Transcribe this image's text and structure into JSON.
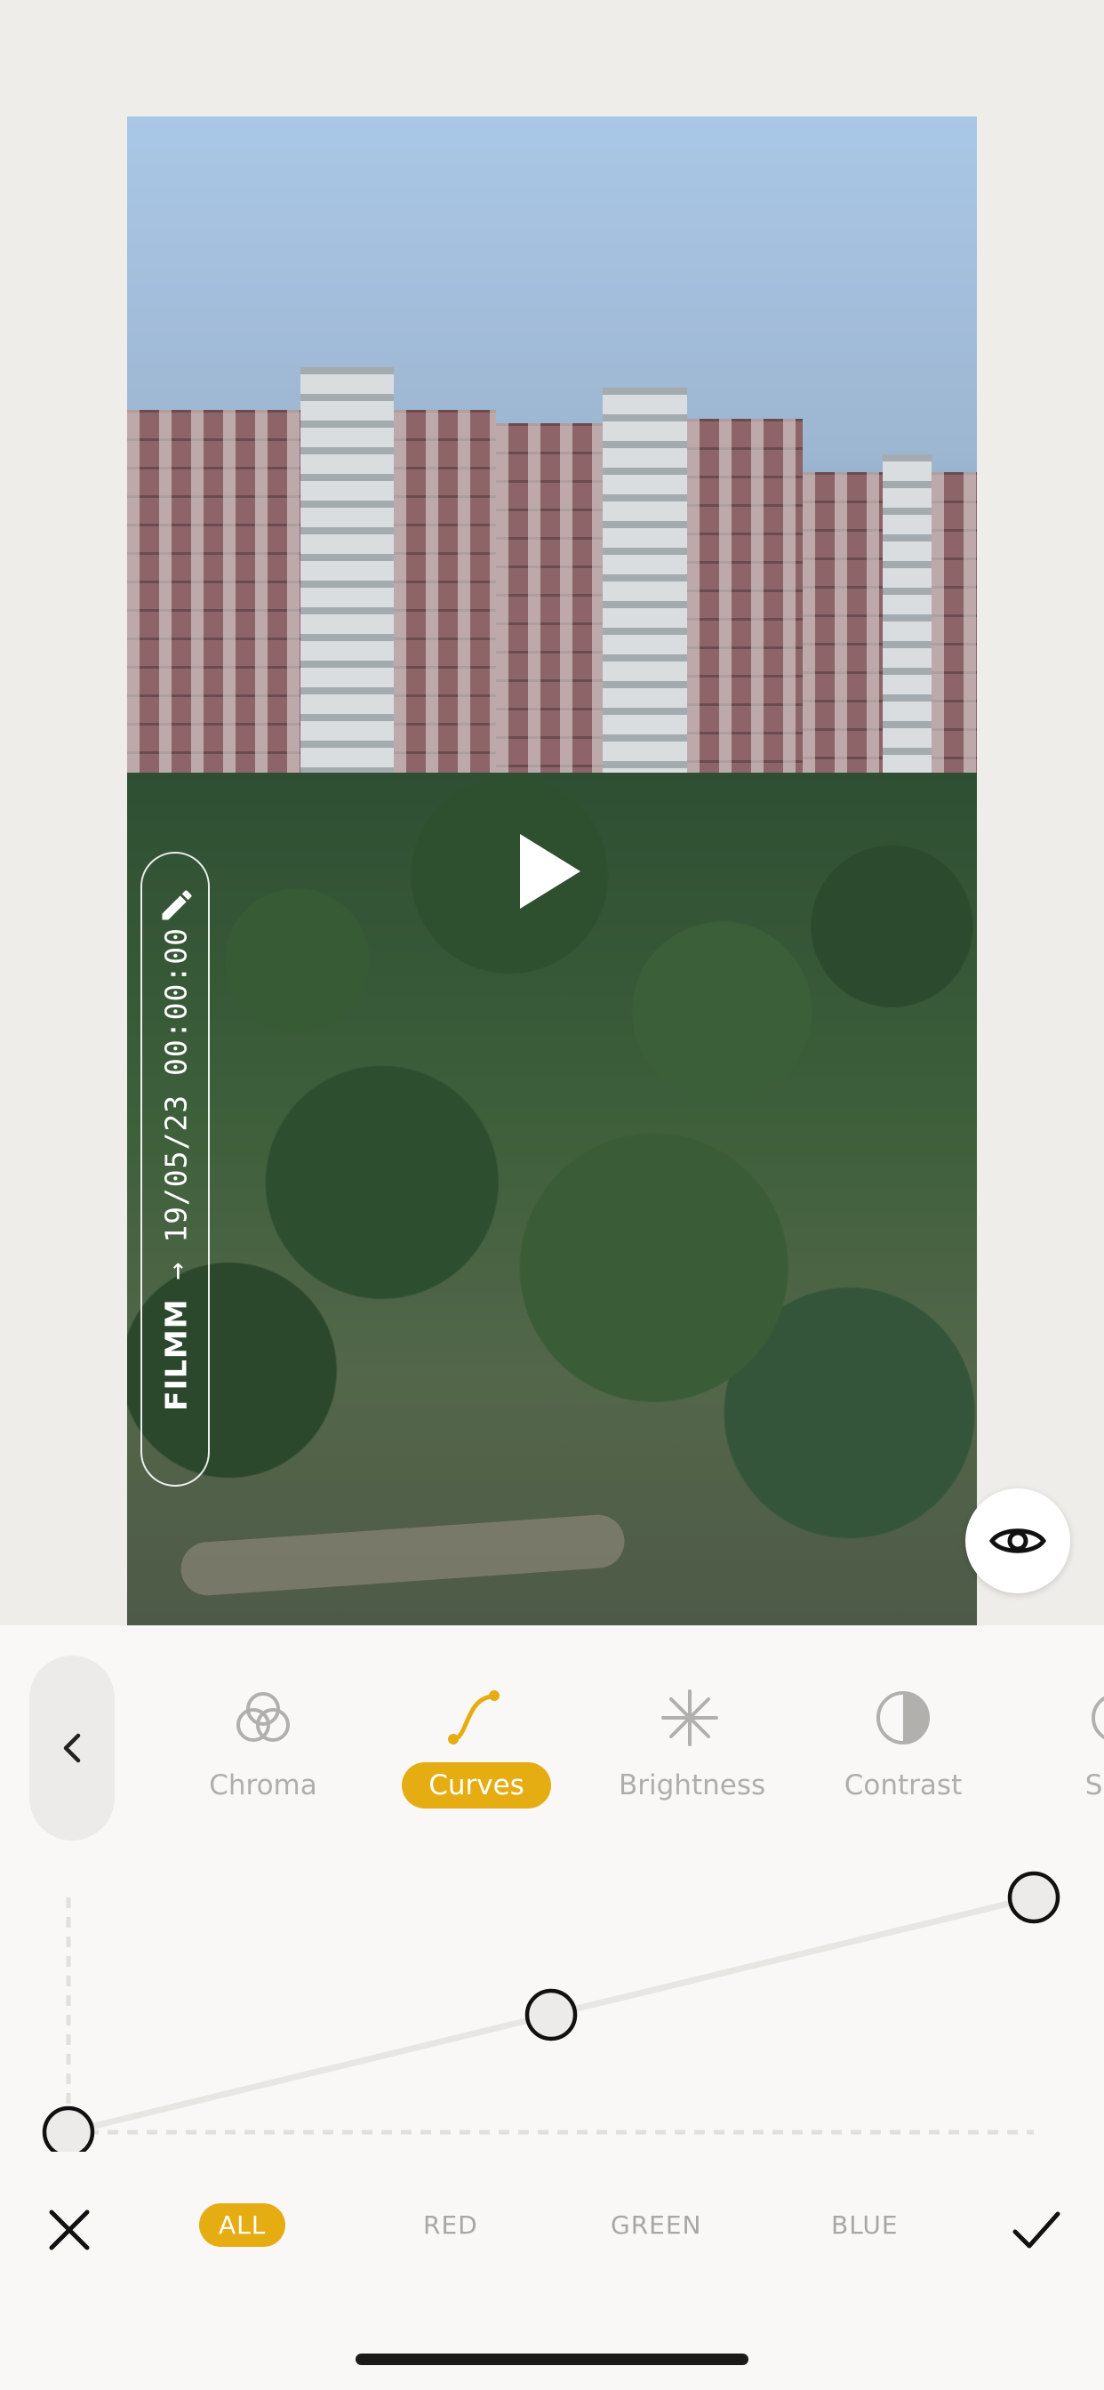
{
  "preview": {
    "timestamp_brand": "FILMM",
    "timestamp_arrow": "→",
    "timestamp_value": "19/05/23 00:00:00"
  },
  "icons": {
    "play": "play-icon",
    "edit": "pencil-icon",
    "compare": "eye-icon",
    "back": "chevron-left-icon",
    "cancel": "close-icon",
    "confirm": "checkmark-icon"
  },
  "tools": [
    {
      "label": "Chroma",
      "icon": "chroma-icon",
      "active": false
    },
    {
      "label": "Curves",
      "icon": "curves-icon",
      "active": true
    },
    {
      "label": "Brightness",
      "icon": "brightness-icon",
      "active": false
    },
    {
      "label": "Contrast",
      "icon": "contrast-icon",
      "active": false
    },
    {
      "label": "Satu",
      "icon": "saturation-icon",
      "active": false
    }
  ],
  "curve": {
    "points": [
      {
        "input": 0.0,
        "output": 0.0
      },
      {
        "input": 0.5,
        "output": 0.5
      },
      {
        "input": 1.0,
        "output": 1.0
      }
    ]
  },
  "channels": [
    {
      "label": "ALL",
      "active": true
    },
    {
      "label": "RED",
      "active": false
    },
    {
      "label": "GREEN",
      "active": false
    },
    {
      "label": "BLUE",
      "active": false
    }
  ],
  "colors": {
    "accent": "#e6ad12",
    "panel_bg": "#faf8f6",
    "page_bg": "#efedea"
  }
}
